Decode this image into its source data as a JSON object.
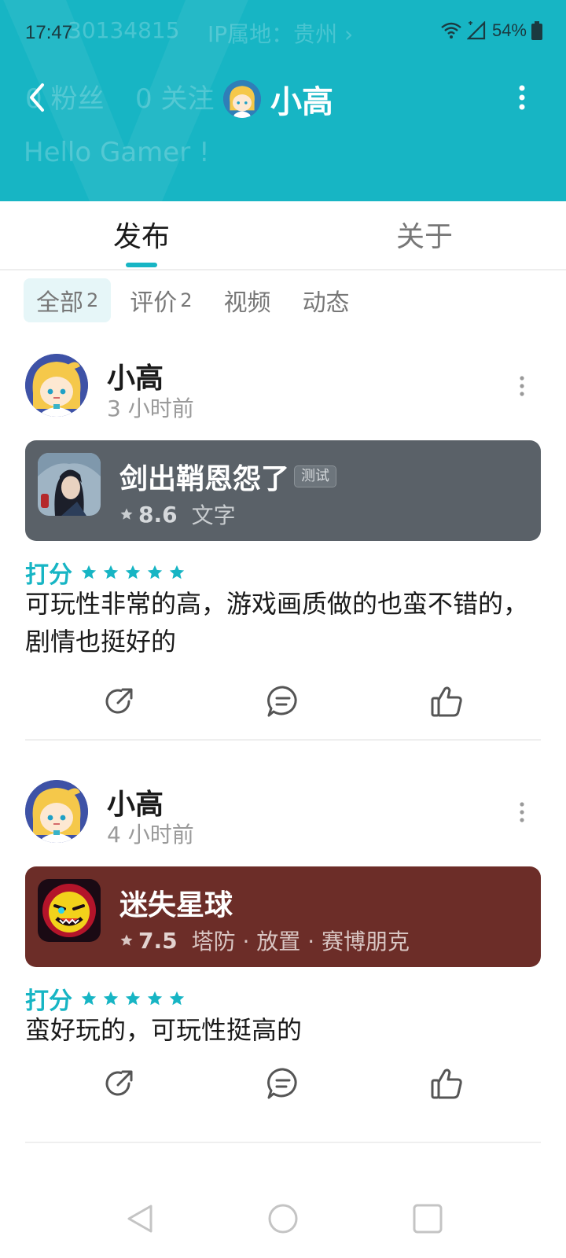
{
  "status_bar": {
    "time": "17:47",
    "battery": "54%"
  },
  "header_background": {
    "user_id": "30134815",
    "ip_location": "IP属地：贵州 ›",
    "fans": "0 粉丝",
    "following": "0 关注",
    "bio": "Hello Gamer !"
  },
  "header": {
    "title": "小高",
    "accent_color": "#17b5c4"
  },
  "tabs": [
    {
      "label": "发布",
      "active": true
    },
    {
      "label": "关于",
      "active": false
    }
  ],
  "filters": [
    {
      "label": "全部",
      "count": "2",
      "active": true
    },
    {
      "label": "评价",
      "count": "2",
      "active": false
    },
    {
      "label": "视频",
      "count": "",
      "active": false
    },
    {
      "label": "动态",
      "count": "",
      "active": false
    }
  ],
  "posts": [
    {
      "author": "小高",
      "time": "3 小时前",
      "game": {
        "name": "剑出鞘恩怨了",
        "badge": "测试",
        "score": "8.6",
        "tags": "文字",
        "card_color": "#5a6168"
      },
      "rating_label": "打分",
      "stars": 5,
      "text": "可玩性非常的高，游戏画质做的也蛮不错的，剧情也挺好的"
    },
    {
      "author": "小高",
      "time": "4 小时前",
      "game": {
        "name": "迷失星球",
        "badge": "",
        "score": "7.5",
        "tags": "塔防 · 放置 · 赛博朋克",
        "card_color": "#6c2d28"
      },
      "rating_label": "打分",
      "stars": 5,
      "text": "蛮好玩的，可玩性挺高的"
    }
  ]
}
